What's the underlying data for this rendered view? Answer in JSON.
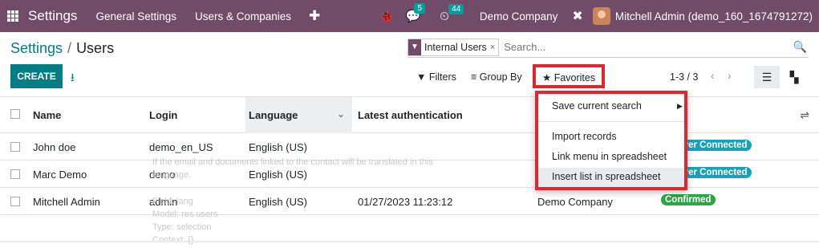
{
  "navbar": {
    "brand": "Settings",
    "menu": [
      "General Settings",
      "Users & Companies"
    ],
    "chat_badge": "5",
    "activity_badge": "44",
    "company": "Demo Company",
    "user": "Mitchell Admin (demo_160_1674791272)"
  },
  "breadcrumb": {
    "parent": "Settings",
    "sep": "/",
    "current": "Users"
  },
  "search": {
    "facet": "Internal Users",
    "facet_remove": "×",
    "placeholder": "Search..."
  },
  "toolbar": {
    "create": "CREATE",
    "filters": "Filters",
    "group_by": "Group By",
    "favorites": "Favorites",
    "pager": "1-3 / 3"
  },
  "table": {
    "headers": [
      "Name",
      "Login",
      "Language",
      "Latest authentication"
    ],
    "rows": [
      {
        "name": "John doe",
        "login": "demo_en_US",
        "language": "English (US)",
        "auth": "",
        "company": "",
        "status": "Never Connected"
      },
      {
        "name": "Marc Demo",
        "login": "demo",
        "language": "English (US)",
        "auth": "",
        "company": "",
        "status": "Never Connected"
      },
      {
        "name": "Mitchell Admin",
        "login": "admin",
        "language": "English (US)",
        "auth": "01/27/2023 11:23:12",
        "company": "Demo Company",
        "status": "Confirmed"
      }
    ]
  },
  "favorites_menu": {
    "save_search": "Save current search",
    "import": "Import records",
    "link_menu": "Link menu in spreadsheet",
    "insert_list": "Insert list in spreadsheet"
  },
  "ghost_tooltip": {
    "line1": "If the email and documents linked to the contact will be translated in this",
    "line2": "language.",
    "line3": "Field: lang",
    "line4": "Model: res.users",
    "line5": "Type: selection",
    "line6": "Context: {}"
  }
}
